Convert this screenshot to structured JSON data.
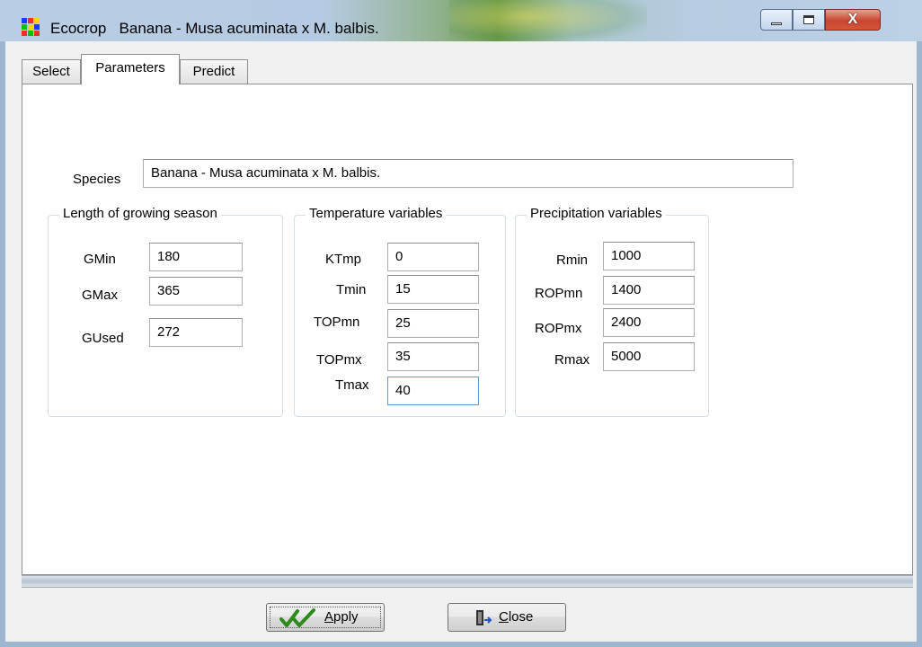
{
  "window": {
    "title": "Ecocrop   Banana - Musa acuminata x M. balbis.",
    "close_glyph": "X"
  },
  "tabs": [
    {
      "label": "Select"
    },
    {
      "label": "Parameters"
    },
    {
      "label": "Predict"
    }
  ],
  "species": {
    "label": "Species",
    "value": "Banana - Musa acuminata x M. balbis."
  },
  "growing_season": {
    "title": "Length of growing season",
    "fields": [
      {
        "label": "GMin",
        "value": "180"
      },
      {
        "label": "GMax",
        "value": "365"
      },
      {
        "label": "GUsed",
        "value": "272"
      }
    ]
  },
  "temperature": {
    "title": "Temperature variables",
    "fields": [
      {
        "label": "KTmp",
        "value": "0"
      },
      {
        "label": "Tmin",
        "value": "15"
      },
      {
        "label": "TOPmn",
        "value": "25"
      },
      {
        "label": "TOPmx",
        "value": "35"
      },
      {
        "label": "Tmax",
        "value": "40"
      }
    ]
  },
  "precipitation": {
    "title": "Precipitation variables",
    "fields": [
      {
        "label": "Rmin",
        "value": "1000"
      },
      {
        "label": "ROPmn",
        "value": "1400"
      },
      {
        "label": "ROPmx",
        "value": "2400"
      },
      {
        "label": "Rmax",
        "value": "5000"
      }
    ]
  },
  "buttons": {
    "apply": "Apply",
    "close": "Close"
  },
  "colors": {
    "apply_check": "#2f8a1e",
    "titlebar_accent": "#6a9a4a",
    "close_button": "#c8452f"
  },
  "icons": {
    "app": "ecocrop-grid-icon",
    "apply": "double-checkmark-icon",
    "close": "exit-door-icon"
  }
}
